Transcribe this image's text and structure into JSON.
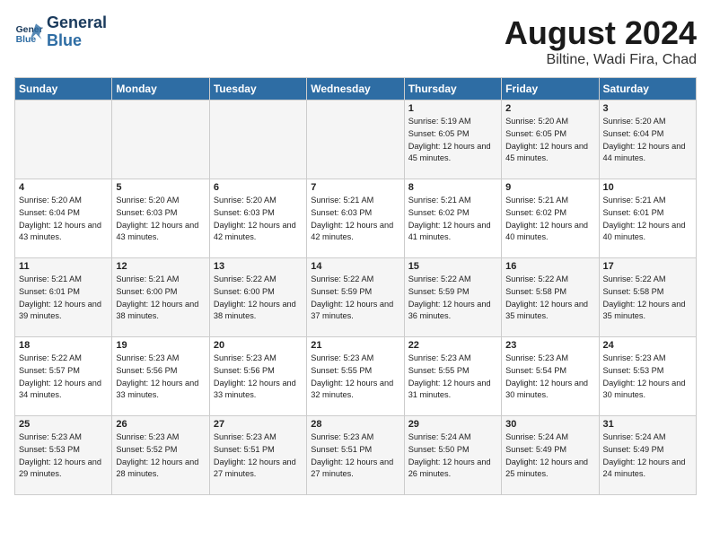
{
  "header": {
    "logo_line1": "General",
    "logo_line2": "Blue",
    "title": "August 2024",
    "subtitle": "Biltine, Wadi Fira, Chad"
  },
  "days_of_week": [
    "Sunday",
    "Monday",
    "Tuesday",
    "Wednesday",
    "Thursday",
    "Friday",
    "Saturday"
  ],
  "weeks": [
    [
      {
        "day": "",
        "sunrise": "",
        "sunset": "",
        "daylight": ""
      },
      {
        "day": "",
        "sunrise": "",
        "sunset": "",
        "daylight": ""
      },
      {
        "day": "",
        "sunrise": "",
        "sunset": "",
        "daylight": ""
      },
      {
        "day": "",
        "sunrise": "",
        "sunset": "",
        "daylight": ""
      },
      {
        "day": "1",
        "sunrise": "5:19 AM",
        "sunset": "6:05 PM",
        "daylight": "12 hours and 45 minutes."
      },
      {
        "day": "2",
        "sunrise": "5:20 AM",
        "sunset": "6:05 PM",
        "daylight": "12 hours and 45 minutes."
      },
      {
        "day": "3",
        "sunrise": "5:20 AM",
        "sunset": "6:04 PM",
        "daylight": "12 hours and 44 minutes."
      }
    ],
    [
      {
        "day": "4",
        "sunrise": "5:20 AM",
        "sunset": "6:04 PM",
        "daylight": "12 hours and 43 minutes."
      },
      {
        "day": "5",
        "sunrise": "5:20 AM",
        "sunset": "6:03 PM",
        "daylight": "12 hours and 43 minutes."
      },
      {
        "day": "6",
        "sunrise": "5:20 AM",
        "sunset": "6:03 PM",
        "daylight": "12 hours and 42 minutes."
      },
      {
        "day": "7",
        "sunrise": "5:21 AM",
        "sunset": "6:03 PM",
        "daylight": "12 hours and 42 minutes."
      },
      {
        "day": "8",
        "sunrise": "5:21 AM",
        "sunset": "6:02 PM",
        "daylight": "12 hours and 41 minutes."
      },
      {
        "day": "9",
        "sunrise": "5:21 AM",
        "sunset": "6:02 PM",
        "daylight": "12 hours and 40 minutes."
      },
      {
        "day": "10",
        "sunrise": "5:21 AM",
        "sunset": "6:01 PM",
        "daylight": "12 hours and 40 minutes."
      }
    ],
    [
      {
        "day": "11",
        "sunrise": "5:21 AM",
        "sunset": "6:01 PM",
        "daylight": "12 hours and 39 minutes."
      },
      {
        "day": "12",
        "sunrise": "5:21 AM",
        "sunset": "6:00 PM",
        "daylight": "12 hours and 38 minutes."
      },
      {
        "day": "13",
        "sunrise": "5:22 AM",
        "sunset": "6:00 PM",
        "daylight": "12 hours and 38 minutes."
      },
      {
        "day": "14",
        "sunrise": "5:22 AM",
        "sunset": "5:59 PM",
        "daylight": "12 hours and 37 minutes."
      },
      {
        "day": "15",
        "sunrise": "5:22 AM",
        "sunset": "5:59 PM",
        "daylight": "12 hours and 36 minutes."
      },
      {
        "day": "16",
        "sunrise": "5:22 AM",
        "sunset": "5:58 PM",
        "daylight": "12 hours and 35 minutes."
      },
      {
        "day": "17",
        "sunrise": "5:22 AM",
        "sunset": "5:58 PM",
        "daylight": "12 hours and 35 minutes."
      }
    ],
    [
      {
        "day": "18",
        "sunrise": "5:22 AM",
        "sunset": "5:57 PM",
        "daylight": "12 hours and 34 minutes."
      },
      {
        "day": "19",
        "sunrise": "5:23 AM",
        "sunset": "5:56 PM",
        "daylight": "12 hours and 33 minutes."
      },
      {
        "day": "20",
        "sunrise": "5:23 AM",
        "sunset": "5:56 PM",
        "daylight": "12 hours and 33 minutes."
      },
      {
        "day": "21",
        "sunrise": "5:23 AM",
        "sunset": "5:55 PM",
        "daylight": "12 hours and 32 minutes."
      },
      {
        "day": "22",
        "sunrise": "5:23 AM",
        "sunset": "5:55 PM",
        "daylight": "12 hours and 31 minutes."
      },
      {
        "day": "23",
        "sunrise": "5:23 AM",
        "sunset": "5:54 PM",
        "daylight": "12 hours and 30 minutes."
      },
      {
        "day": "24",
        "sunrise": "5:23 AM",
        "sunset": "5:53 PM",
        "daylight": "12 hours and 30 minutes."
      }
    ],
    [
      {
        "day": "25",
        "sunrise": "5:23 AM",
        "sunset": "5:53 PM",
        "daylight": "12 hours and 29 minutes."
      },
      {
        "day": "26",
        "sunrise": "5:23 AM",
        "sunset": "5:52 PM",
        "daylight": "12 hours and 28 minutes."
      },
      {
        "day": "27",
        "sunrise": "5:23 AM",
        "sunset": "5:51 PM",
        "daylight": "12 hours and 27 minutes."
      },
      {
        "day": "28",
        "sunrise": "5:23 AM",
        "sunset": "5:51 PM",
        "daylight": "12 hours and 27 minutes."
      },
      {
        "day": "29",
        "sunrise": "5:24 AM",
        "sunset": "5:50 PM",
        "daylight": "12 hours and 26 minutes."
      },
      {
        "day": "30",
        "sunrise": "5:24 AM",
        "sunset": "5:49 PM",
        "daylight": "12 hours and 25 minutes."
      },
      {
        "day": "31",
        "sunrise": "5:24 AM",
        "sunset": "5:49 PM",
        "daylight": "12 hours and 24 minutes."
      }
    ]
  ]
}
